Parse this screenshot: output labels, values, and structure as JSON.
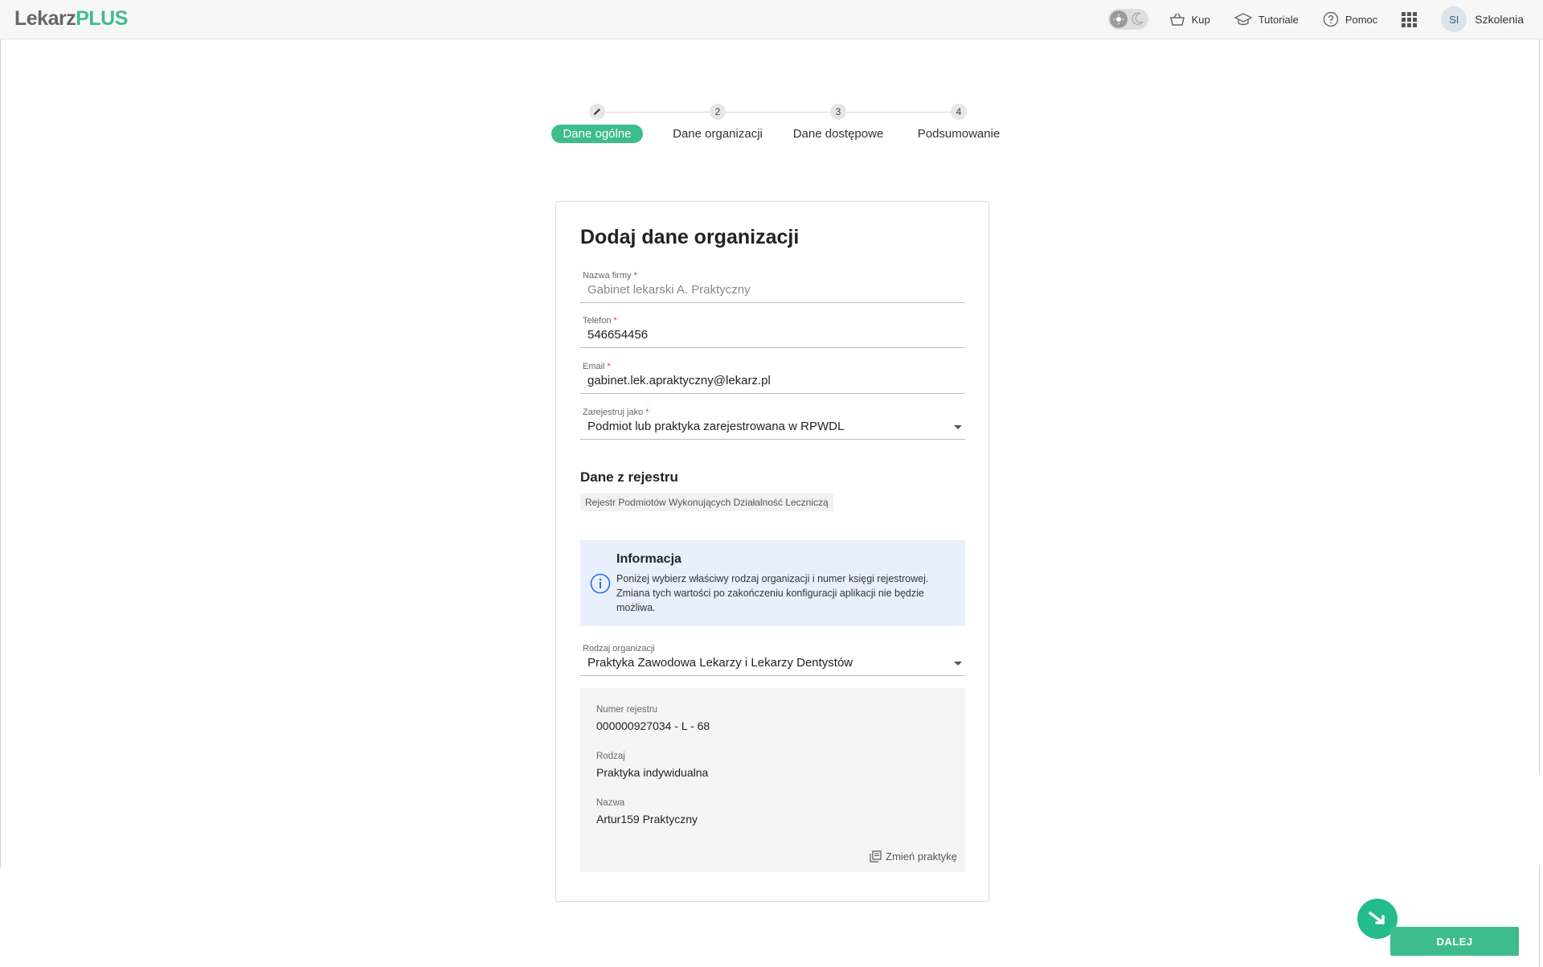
{
  "header": {
    "logo_part1": "Lekarz",
    "logo_part2": "PLUS",
    "nav": {
      "buy": "Kup",
      "tutorials": "Tutoriale",
      "help": "Pomoc"
    },
    "user": {
      "initials": "SI",
      "name": "Szkolenia"
    }
  },
  "stepper": {
    "steps": [
      {
        "num": "",
        "label": "Dane ogólne",
        "active": true
      },
      {
        "num": "2",
        "label": "Dane organizacji",
        "active": false
      },
      {
        "num": "3",
        "label": "Dane dostępowe",
        "active": false
      },
      {
        "num": "4",
        "label": "Podsumowanie",
        "active": false
      }
    ]
  },
  "form": {
    "title": "Dodaj dane organizacji",
    "company_name": {
      "label": "Nazwa firmy",
      "required": "*",
      "value": "Gabinet lekarski A. Praktyczny"
    },
    "phone": {
      "label": "Telefon",
      "required": "*",
      "value": "546654456"
    },
    "email": {
      "label": "Email",
      "required": "*",
      "value": "gabinet.lek.apraktyczny@lekarz.pl"
    },
    "register_as": {
      "label": "Zarejestruj jako",
      "required": "*",
      "value": "Podmiot lub praktyka zarejestrowana w RPWDL"
    },
    "registry_section": {
      "title": "Dane z rejestru",
      "chip": "Rejestr Podmiotów Wykonujących Działalność Leczniczą"
    },
    "info": {
      "title": "Informacja",
      "text": "Poniżej wybierz właściwy rodzaj organizacji i numer księgi rejestrowej. Zmiana tych wartości po zakończeniu konfiguracji aplikacji nie będzie możliwa."
    },
    "org_type": {
      "label": "Rodzaj organizacji",
      "value": "Praktyka Zawodowa Lekarzy i Lekarzy Dentystów"
    },
    "practice": {
      "register_number": {
        "label": "Numer rejestru",
        "value": "000000927034 - L - 68"
      },
      "kind": {
        "label": "Rodzaj",
        "value": "Praktyka indywidualna"
      },
      "name": {
        "label": "Nazwa",
        "value": "Artur159 Praktyczny"
      },
      "change_label": "Zmień praktykę"
    }
  },
  "footer": {
    "next_label": "DALEJ"
  },
  "colors": {
    "accent": "#3ebd8c",
    "fab": "#25bb8c",
    "info_bg": "#e8f0fd",
    "required": "#e53935"
  }
}
